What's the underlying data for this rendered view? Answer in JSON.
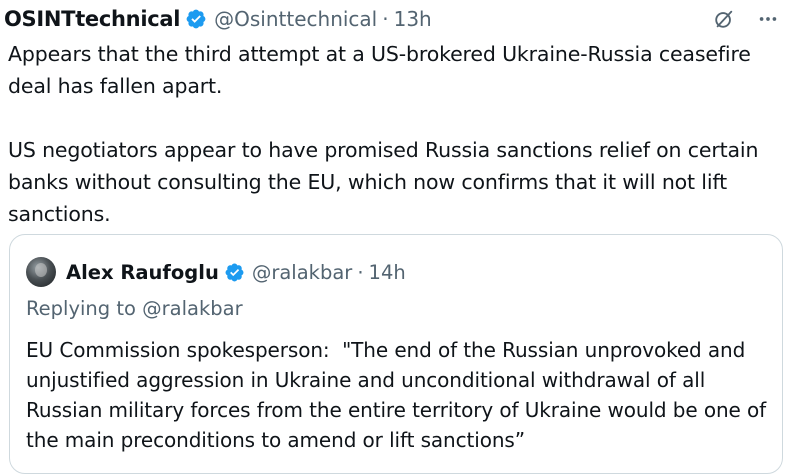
{
  "tweet": {
    "author_name": "OSINTtechnical",
    "handle": "@Osinttechnical",
    "separator": "·",
    "time": "13h",
    "paragraphs": [
      "Appears that the third attempt at a US-brokered Ukraine-Russia ceasefire deal has fallen apart.",
      "US negotiators appear to have promised Russia sanctions relief on certain banks without consulting the EU, which now confirms that it will not lift sanctions."
    ],
    "icons": [
      "verified-badge-icon",
      "grok-icon",
      "more-icon"
    ]
  },
  "quote": {
    "author_name": "Alex Raufoglu",
    "handle": "@ralakbar",
    "separator": "·",
    "time": "14h",
    "replying_to": "Replying to @ralakbar",
    "text": "EU Commission spokesperson:  \"The end of the Russian unprovoked and unjustified aggression in Ukraine and unconditional withdrawal of all Russian military forces from the entire territory of Ukraine would be one of the main preconditions to amend or lift sanctions”"
  },
  "colors": {
    "verified_blue": "#1d9bf0",
    "secondary_text": "#536471",
    "border": "#cfd9de",
    "text": "#0f1419"
  }
}
